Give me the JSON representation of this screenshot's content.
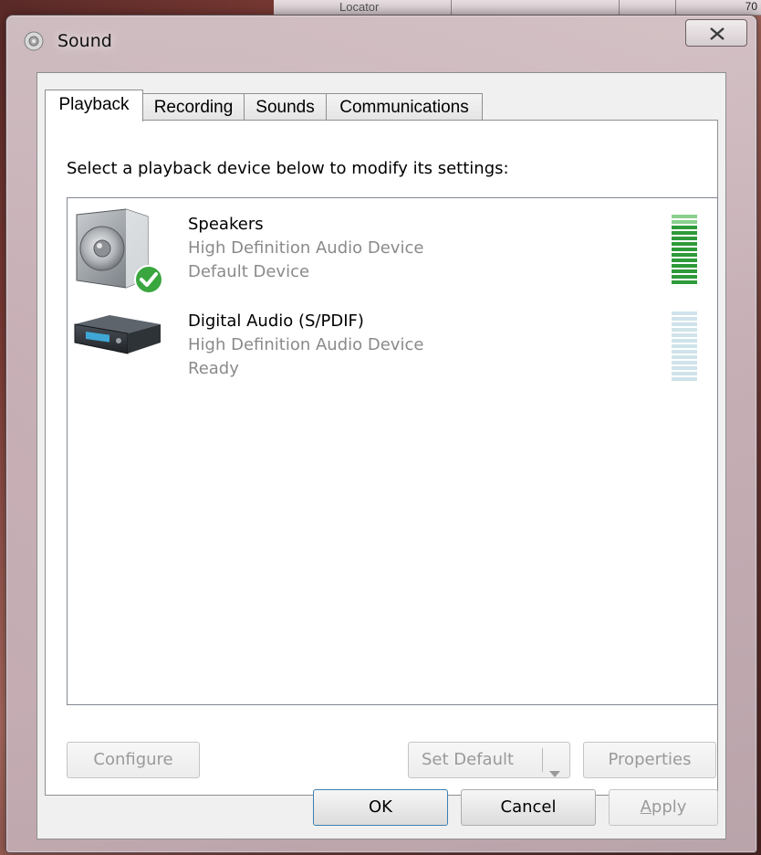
{
  "background": {
    "behind_window_text": "Locator",
    "behind_window_right_text": "70"
  },
  "window": {
    "title": "Sound",
    "title_icon": "speaker-icon",
    "close_icon": "close-icon"
  },
  "tabs": [
    {
      "label": "Playback",
      "active": true
    },
    {
      "label": "Recording",
      "active": false
    },
    {
      "label": "Sounds",
      "active": false
    },
    {
      "label": "Communications",
      "active": false
    }
  ],
  "playback": {
    "instruction": "Select a playback device below to modify its settings:",
    "devices": [
      {
        "name": "Speakers",
        "description": "High Definition Audio Device",
        "status": "Default Device",
        "icon": "speaker-device-icon",
        "default_badge_icon": "green-check-icon",
        "meter_level": 1.0,
        "meter_color": "#2e9a3a"
      },
      {
        "name": "Digital Audio (S/PDIF)",
        "description": "High Definition Audio Device",
        "status": "Ready",
        "icon": "digital-audio-device-icon",
        "meter_level": 0.0,
        "meter_color": "#cfe3ea"
      }
    ],
    "buttons": {
      "configure": "Configure",
      "set_default": "Set Default",
      "properties": "Properties"
    }
  },
  "dialog_buttons": {
    "ok": "OK",
    "cancel": "Cancel",
    "apply": "Apply"
  }
}
